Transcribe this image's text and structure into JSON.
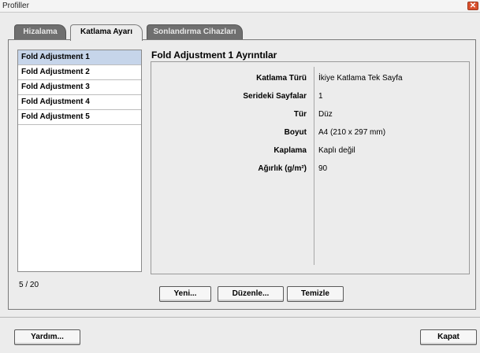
{
  "window": {
    "title": "Profiller",
    "close_label": "✕"
  },
  "tabs": [
    {
      "label": "Hizalama",
      "active": false
    },
    {
      "label": "Katlama Ayarı",
      "active": true
    },
    {
      "label": "Sonlandırma Cihazları",
      "active": false
    }
  ],
  "list": {
    "items": [
      {
        "label": "Fold Adjustment 1",
        "selected": true
      },
      {
        "label": "Fold Adjustment 2",
        "selected": false
      },
      {
        "label": "Fold Adjustment 3",
        "selected": false
      },
      {
        "label": "Fold Adjustment 4",
        "selected": false
      },
      {
        "label": "Fold Adjustment 5",
        "selected": false
      }
    ],
    "count": "5 / 20"
  },
  "details": {
    "title": "Fold Adjustment 1 Ayrıntılar",
    "rows": [
      {
        "label": "Katlama Türü",
        "value": "İkiye Katlama Tek Sayfa"
      },
      {
        "label": "Serideki Sayfalar",
        "value": "1"
      },
      {
        "label": "Tür",
        "value": "Düz"
      },
      {
        "label": "Boyut",
        "value": "A4 (210 x 297 mm)"
      },
      {
        "label": "Kaplama",
        "value": "Kaplı değil"
      },
      {
        "label": "Ağırlık (g/m²)",
        "value": "90"
      }
    ]
  },
  "actions": {
    "new_label": "Yeni...",
    "edit_label": "Düzenle...",
    "clear_label": "Temizle"
  },
  "footer": {
    "help_label": "Yardım...",
    "close_label": "Kapat"
  }
}
